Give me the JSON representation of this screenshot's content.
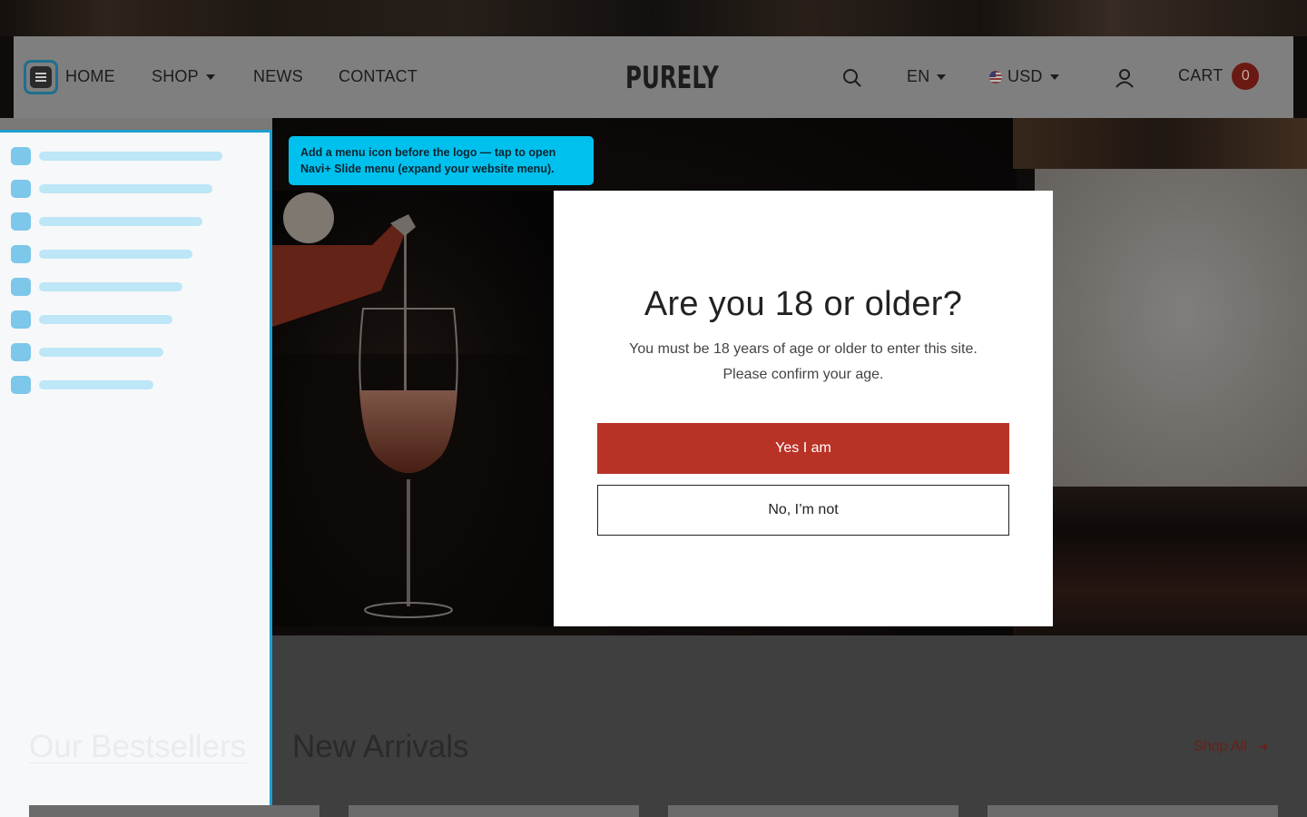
{
  "header": {
    "nav": {
      "home": "HOME",
      "shop": "SHOP",
      "news": "NEWS",
      "contact": "CONTACT"
    },
    "logo": "PURELY",
    "language": "EN",
    "currency": "USD",
    "cart_label": "CART",
    "cart_count": "0",
    "icons": [
      "menu-icon",
      "search-icon",
      "user-icon",
      "flag-us-icon",
      "chevron-down-icon"
    ]
  },
  "tooltip": {
    "text": "Add a menu icon before the logo — tap to open Navi+ Slide menu (expand your website menu)."
  },
  "age_gate": {
    "title": "Are you 18 or older?",
    "message_line1": "You must be 18 years of age or older to enter this site.",
    "message_line2": "Please confirm your age.",
    "yes_label": "Yes I am",
    "no_label": "No, I’m not"
  },
  "products": {
    "tab_bestsellers": "Our Bestsellers",
    "tab_new_arrivals": "New Arrivals",
    "shop_all": "Shop All"
  },
  "colors": {
    "accent_red": "#b93226",
    "tooltip_cyan": "#00c1ee",
    "panel_border": "#1e9fd0",
    "skeleton_icon": "#7cc7ea",
    "skeleton_bar": "#bde6f6"
  }
}
